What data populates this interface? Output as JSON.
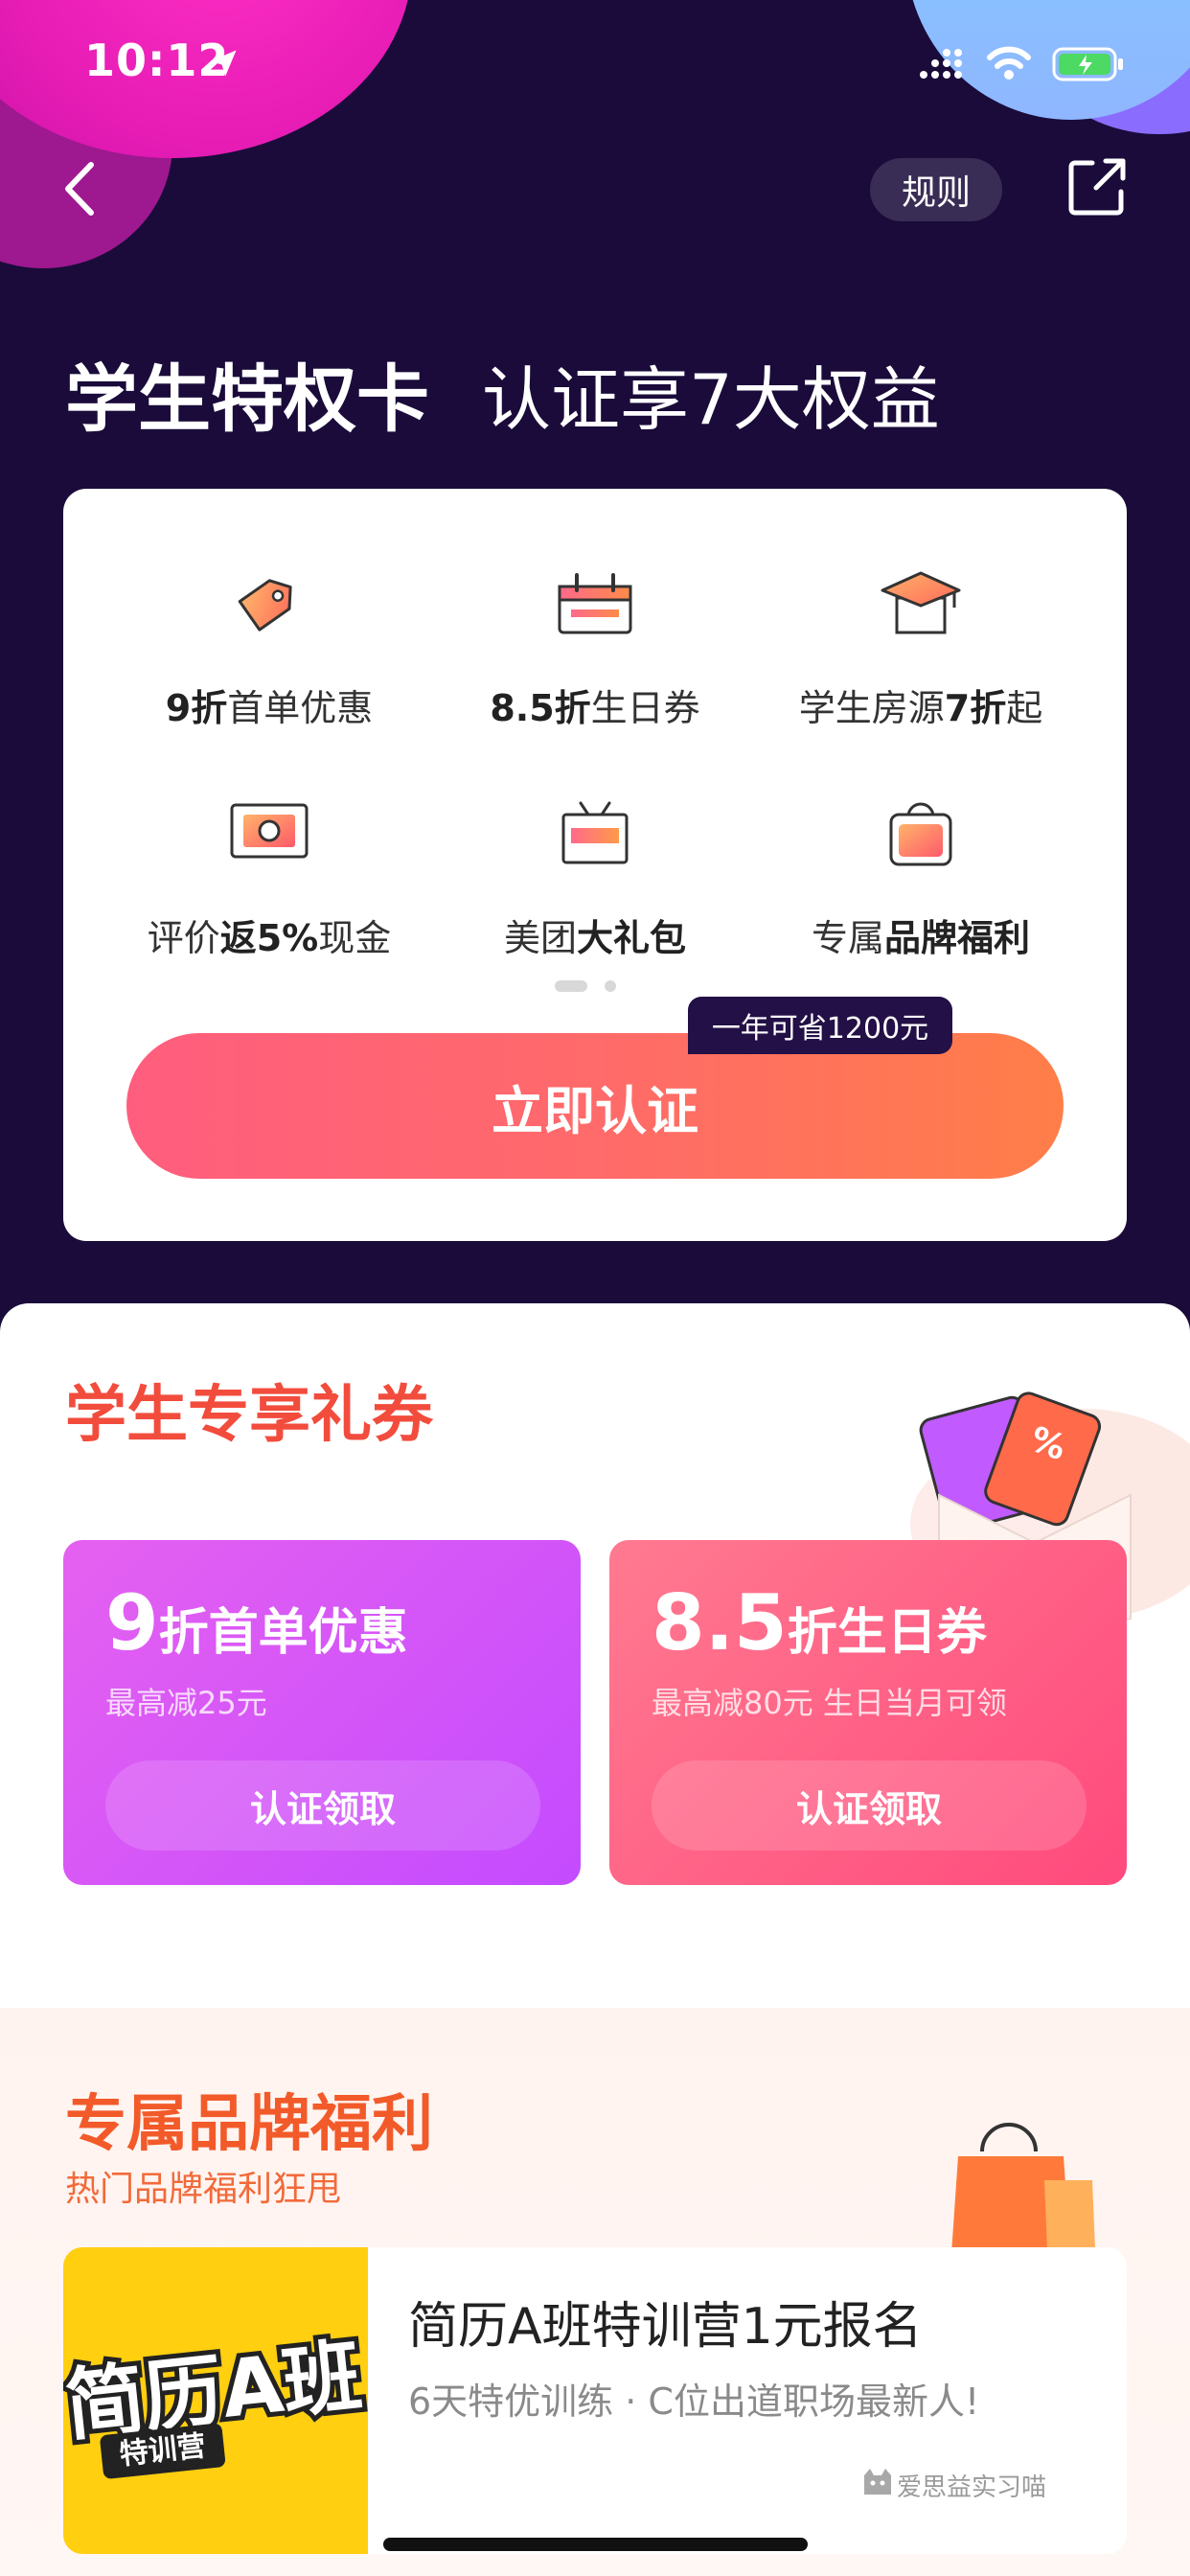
{
  "status_bar": {
    "time": "10:12"
  },
  "header": {
    "rules_label": "规则"
  },
  "hero": {
    "title": "学生特权卡",
    "subtitle": "认证享7大权益"
  },
  "benefits": {
    "items": [
      {
        "icon": "tag-icon",
        "bold": "9折",
        "text": "首单优惠",
        "order": "bold-first"
      },
      {
        "icon": "calendar-icon",
        "bold": "8.5折",
        "text": "生日券",
        "order": "bold-first"
      },
      {
        "icon": "graduation-house-icon",
        "pre": "学生房源",
        "bold": "7折",
        "post": "起"
      },
      {
        "icon": "cash-review-icon",
        "pre": "评价",
        "bold": "返5%",
        "post": "现金"
      },
      {
        "icon": "gift-box-icon",
        "pre": "美团",
        "bold": "大礼包",
        "post": ""
      },
      {
        "icon": "shopping-bag-icon",
        "pre": "专属",
        "bold": "品牌福利",
        "post": ""
      }
    ],
    "page_count": 2,
    "active_page": 1,
    "cta_label": "立即认证",
    "cta_tip": "一年可省1200元"
  },
  "coupons": {
    "title": "学生专享礼券",
    "items": [
      {
        "big": "9",
        "rest": "折首单优惠",
        "desc": "最高减25元",
        "button": "认证领取",
        "color": "#c44bff"
      },
      {
        "big": "8.5",
        "rest": "折生日券",
        "desc": "最高减80元 生日当月可领",
        "button": "认证领取",
        "color": "#ff4a7d"
      }
    ]
  },
  "brand": {
    "title": "专属品牌福利",
    "subtitle": "热门品牌福利狂甩",
    "card": {
      "logo_text_main": "简历A班",
      "logo_text_badge": "特训营",
      "name": "简历A班特训营1元报名",
      "desc": "6天特优训练 · C位出道职场最新人!",
      "source": "爱思益实习喵"
    }
  },
  "colors": {
    "hero_bg": "#1a0b3a",
    "accent_red": "#f24c3d",
    "cta_start": "#ff5d7e",
    "cta_end": "#ff7e48"
  }
}
